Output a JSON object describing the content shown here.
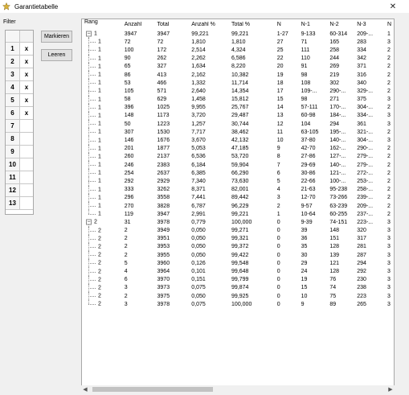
{
  "window": {
    "title": "Garantietabelle",
    "close_symbol": "✕"
  },
  "filter": {
    "label": "Filter",
    "rows": [
      {
        "num": "1",
        "val": "x"
      },
      {
        "num": "2",
        "val": "x"
      },
      {
        "num": "3",
        "val": "x"
      },
      {
        "num": "4",
        "val": "x"
      },
      {
        "num": "5",
        "val": "x"
      },
      {
        "num": "6",
        "val": "x"
      },
      {
        "num": "7",
        "val": ""
      },
      {
        "num": "8",
        "val": ""
      },
      {
        "num": "9",
        "val": ""
      },
      {
        "num": "10",
        "val": ""
      },
      {
        "num": "11",
        "val": ""
      },
      {
        "num": "12",
        "val": ""
      },
      {
        "num": "13",
        "val": ""
      }
    ]
  },
  "buttons": {
    "mark": "Markieren",
    "clear": "Leeren"
  },
  "table": {
    "columns": [
      "Rang",
      "Anzahl",
      "Total",
      "Anzahl %",
      "Total %",
      "N",
      "N-1",
      "N-2",
      "N-3",
      "N"
    ],
    "rows": [
      {
        "level": 0,
        "expander": "−",
        "cells": [
          "1",
          "3947",
          "3947",
          "99,221",
          "99,221",
          "1-27",
          "9-133",
          "60-314",
          "209-...",
          "1"
        ]
      },
      {
        "level": 1,
        "cells": [
          "1",
          "72",
          "72",
          "1,810",
          "1,810",
          "27",
          "71",
          "165",
          "283",
          "3"
        ]
      },
      {
        "level": 1,
        "cells": [
          "1",
          "100",
          "172",
          "2,514",
          "4,324",
          "25",
          "111",
          "258",
          "334",
          "2"
        ]
      },
      {
        "level": 1,
        "cells": [
          "1",
          "90",
          "262",
          "2,262",
          "6,586",
          "22",
          "110",
          "244",
          "342",
          "2"
        ]
      },
      {
        "level": 1,
        "cells": [
          "1",
          "65",
          "327",
          "1,634",
          "8,220",
          "20",
          "91",
          "269",
          "371",
          "2"
        ]
      },
      {
        "level": 1,
        "cells": [
          "1",
          "86",
          "413",
          "2,162",
          "10,382",
          "19",
          "98",
          "219",
          "316",
          "2"
        ]
      },
      {
        "level": 1,
        "cells": [
          "1",
          "53",
          "466",
          "1,332",
          "11,714",
          "18",
          "108",
          "302",
          "340",
          "2"
        ]
      },
      {
        "level": 1,
        "cells": [
          "1",
          "105",
          "571",
          "2,640",
          "14,354",
          "17",
          "109-...",
          "290-...",
          "329-...",
          "2"
        ]
      },
      {
        "level": 1,
        "cells": [
          "1",
          "58",
          "629",
          "1,458",
          "15,812",
          "15",
          "98",
          "271",
          "375",
          "3"
        ]
      },
      {
        "level": 1,
        "cells": [
          "1",
          "396",
          "1025",
          "9,955",
          "25,767",
          "14",
          "57-111",
          "170-...",
          "304-...",
          "2"
        ]
      },
      {
        "level": 1,
        "cells": [
          "1",
          "148",
          "1173",
          "3,720",
          "29,487",
          "13",
          "60-98",
          "184-...",
          "334-...",
          "3"
        ]
      },
      {
        "level": 1,
        "cells": [
          "1",
          "50",
          "1223",
          "1,257",
          "30,744",
          "12",
          "104",
          "294",
          "361",
          "3"
        ]
      },
      {
        "level": 1,
        "cells": [
          "1",
          "307",
          "1530",
          "7,717",
          "38,462",
          "11",
          "63-105",
          "195-...",
          "321-...",
          "2"
        ]
      },
      {
        "level": 1,
        "cells": [
          "1",
          "146",
          "1676",
          "3,670",
          "42,132",
          "10",
          "37-80",
          "140-...",
          "304-...",
          "3"
        ]
      },
      {
        "level": 1,
        "cells": [
          "1",
          "201",
          "1877",
          "5,053",
          "47,185",
          "9",
          "42-70",
          "162-...",
          "290-...",
          "2"
        ]
      },
      {
        "level": 1,
        "cells": [
          "1",
          "260",
          "2137",
          "6,536",
          "53,720",
          "8",
          "27-86",
          "127-...",
          "279-...",
          "2"
        ]
      },
      {
        "level": 1,
        "cells": [
          "1",
          "246",
          "2383",
          "6,184",
          "59,904",
          "7",
          "29-69",
          "140-...",
          "279-...",
          "2"
        ]
      },
      {
        "level": 1,
        "cells": [
          "1",
          "254",
          "2637",
          "6,385",
          "66,290",
          "6",
          "30-86",
          "121-...",
          "272-...",
          "2"
        ]
      },
      {
        "level": 1,
        "cells": [
          "1",
          "292",
          "2929",
          "7,340",
          "73,630",
          "5",
          "22-66",
          "100-...",
          "253-...",
          "2"
        ]
      },
      {
        "level": 1,
        "cells": [
          "1",
          "333",
          "3262",
          "8,371",
          "82,001",
          "4",
          "21-63",
          "95-238",
          "258-...",
          "2"
        ]
      },
      {
        "level": 1,
        "cells": [
          "1",
          "296",
          "3558",
          "7,441",
          "89,442",
          "3",
          "12-70",
          "73-266",
          "239-...",
          "2"
        ]
      },
      {
        "level": 1,
        "cells": [
          "1",
          "270",
          "3828",
          "6,787",
          "96,229",
          "2",
          "9-57",
          "63-239",
          "209-...",
          "2"
        ]
      },
      {
        "level": 1,
        "cells": [
          "1",
          "119",
          "3947",
          "2,991",
          "99,221",
          "1",
          "10-64",
          "60-255",
          "237-...",
          "2"
        ]
      },
      {
        "level": 0,
        "expander": "−",
        "cells": [
          "2",
          "31",
          "3978",
          "0,779",
          "100,000",
          "0",
          "9-39",
          "74-151",
          "223-...",
          "3"
        ]
      },
      {
        "level": 1,
        "cells": [
          "2",
          "2",
          "3949",
          "0,050",
          "99,271",
          "0",
          "39",
          "148",
          "320",
          "3"
        ]
      },
      {
        "level": 1,
        "cells": [
          "2",
          "2",
          "3951",
          "0,050",
          "99,321",
          "0",
          "36",
          "151",
          "317",
          "3"
        ]
      },
      {
        "level": 1,
        "cells": [
          "2",
          "2",
          "3953",
          "0,050",
          "99,372",
          "0",
          "35",
          "128",
          "281",
          "3"
        ]
      },
      {
        "level": 1,
        "cells": [
          "2",
          "2",
          "3955",
          "0,050",
          "99,422",
          "0",
          "30",
          "139",
          "287",
          "3"
        ]
      },
      {
        "level": 1,
        "cells": [
          "2",
          "5",
          "3960",
          "0,126",
          "99,548",
          "0",
          "29",
          "121",
          "294",
          "3"
        ]
      },
      {
        "level": 1,
        "cells": [
          "2",
          "4",
          "3964",
          "0,101",
          "99,648",
          "0",
          "24",
          "128",
          "292",
          "3"
        ]
      },
      {
        "level": 1,
        "cells": [
          "2",
          "6",
          "3970",
          "0,151",
          "99,799",
          "0",
          "19",
          "76",
          "230",
          "3"
        ]
      },
      {
        "level": 1,
        "cells": [
          "2",
          "3",
          "3973",
          "0,075",
          "99,874",
          "0",
          "15",
          "74",
          "238",
          "3"
        ]
      },
      {
        "level": 1,
        "cells": [
          "2",
          "2",
          "3975",
          "0,050",
          "99,925",
          "0",
          "10",
          "75",
          "223",
          "3"
        ]
      },
      {
        "level": 1,
        "cells": [
          "2",
          "3",
          "3978",
          "0,075",
          "100,000",
          "0",
          "9",
          "89",
          "265",
          "3"
        ]
      }
    ]
  },
  "scrollbar": {
    "left_symbol": "◀",
    "right_symbol": "▶"
  }
}
